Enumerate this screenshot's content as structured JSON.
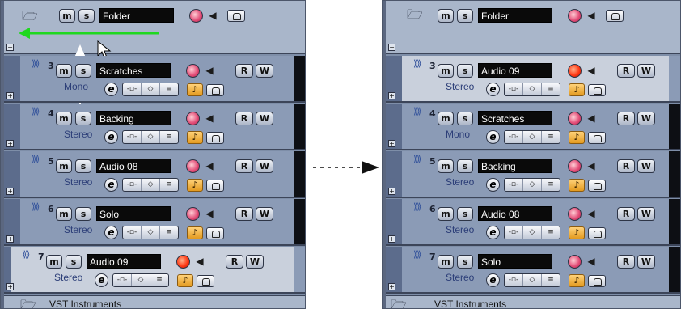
{
  "left": {
    "folder": {
      "name": "Folder",
      "m": "m",
      "s": "s"
    },
    "tracks": [
      {
        "number": "3",
        "name": "Scratches",
        "mode": "Mono",
        "m": "m",
        "s": "s",
        "r": "R",
        "w": "W",
        "e": "e"
      },
      {
        "number": "4",
        "name": "Backing",
        "mode": "Stereo",
        "m": "m",
        "s": "s",
        "r": "R",
        "w": "W",
        "e": "e"
      },
      {
        "number": "5",
        "name": "Audio 08",
        "mode": "Stereo",
        "m": "m",
        "s": "s",
        "r": "R",
        "w": "W",
        "e": "e"
      },
      {
        "number": "6",
        "name": "Solo",
        "mode": "Stereo",
        "m": "m",
        "s": "s",
        "r": "R",
        "w": "W",
        "e": "e"
      },
      {
        "number": "7",
        "name": "Audio 09",
        "mode": "Stereo",
        "m": "m",
        "s": "s",
        "r": "R",
        "w": "W",
        "e": "e",
        "selected": true
      }
    ],
    "bottom_label": "VST Instruments"
  },
  "right": {
    "folder": {
      "name": "Folder",
      "m": "m",
      "s": "s"
    },
    "tracks": [
      {
        "number": "3",
        "name": "Audio 09",
        "mode": "Stereo",
        "m": "m",
        "s": "s",
        "r": "R",
        "w": "W",
        "e": "e",
        "selected": true
      },
      {
        "number": "4",
        "name": "Scratches",
        "mode": "Mono",
        "m": "m",
        "s": "s",
        "r": "R",
        "w": "W",
        "e": "e"
      },
      {
        "number": "5",
        "name": "Backing",
        "mode": "Stereo",
        "m": "m",
        "s": "s",
        "r": "R",
        "w": "W",
        "e": "e"
      },
      {
        "number": "6",
        "name": "Audio 08",
        "mode": "Stereo",
        "m": "m",
        "s": "s",
        "r": "R",
        "w": "W",
        "e": "e"
      },
      {
        "number": "7",
        "name": "Solo",
        "mode": "Stereo",
        "m": "m",
        "s": "s",
        "r": "R",
        "w": "W",
        "e": "e"
      }
    ],
    "bottom_label": "VST Instruments"
  },
  "colors": {
    "drag_arrow": "#1fd81f",
    "between_arrow": "#111111",
    "record_armed": "#ff3b16"
  },
  "icons": [
    "folder-icon",
    "speaker-icon",
    "lock-icon",
    "midi-track-icon",
    "cursor-icon",
    "note-icon"
  ]
}
